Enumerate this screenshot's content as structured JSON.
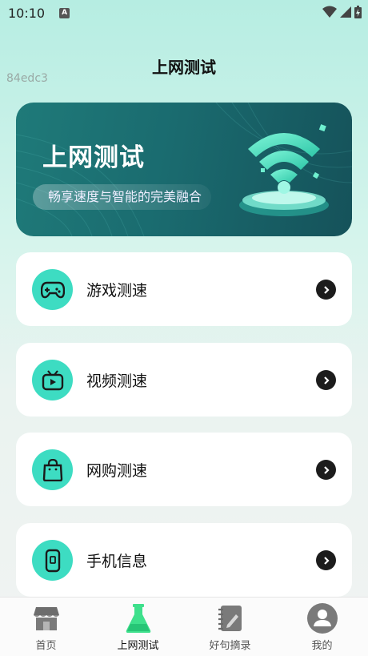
{
  "status_bar": {
    "time": "10:10",
    "notification_glyph": "A"
  },
  "page": {
    "title": "上网测试",
    "debug_id": "84edc3"
  },
  "banner": {
    "title": "上网测试",
    "subtitle": "畅享速度与智能的完美融合"
  },
  "menu": [
    {
      "label": "游戏测速",
      "icon": "gamepad-icon"
    },
    {
      "label": "视频测速",
      "icon": "tv-icon"
    },
    {
      "label": "网购测速",
      "icon": "shopping-bag-icon"
    },
    {
      "label": "手机信息",
      "icon": "phone-icon"
    }
  ],
  "tabs": [
    {
      "label": "首页",
      "icon": "store-icon"
    },
    {
      "label": "上网测试",
      "icon": "flask-icon",
      "active": true
    },
    {
      "label": "好句摘录",
      "icon": "notebook-icon"
    },
    {
      "label": "我的",
      "icon": "user-icon"
    }
  ],
  "colors": {
    "accent": "#3ddcc2",
    "banner": "#1a6b6f",
    "active_tab": "#3ee08c"
  }
}
